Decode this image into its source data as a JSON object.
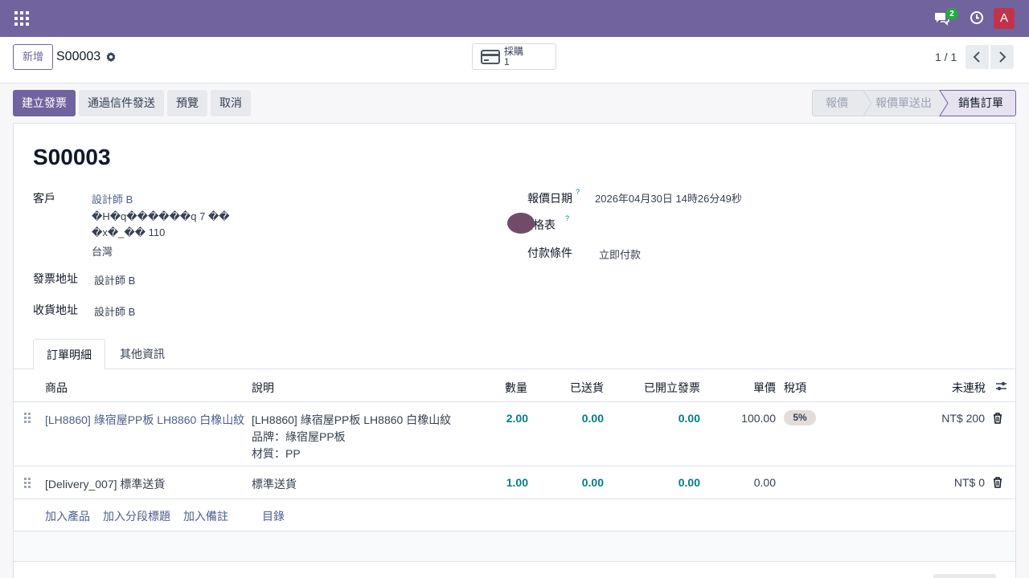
{
  "navbar": {
    "message_count": "2",
    "avatar_initial": "A",
    "accent_color": "#71639e"
  },
  "control": {
    "new_label": "新增",
    "record_name": "S00003",
    "smart_button": {
      "label": "採購",
      "count": "1"
    },
    "pager": "1 / 1"
  },
  "actions": {
    "create_invoice": "建立發票",
    "send_email": "通過信件發送",
    "preview": "預覽",
    "cancel": "取消"
  },
  "statusbar": {
    "stages": [
      "報價",
      "報價單送出",
      "銷售訂單"
    ],
    "active": "銷售訂單"
  },
  "form": {
    "title": "S00003",
    "customer_label": "客戶",
    "customer_name": "設計師 B",
    "customer_address_1": "�H�q������q 7 ��",
    "customer_address_2": "�x�_�� 110",
    "customer_country": "台灣",
    "invoice_address_label": "發票地址",
    "invoice_address": "設計師 B",
    "delivery_address_label": "收貨地址",
    "delivery_address": "設計師 B",
    "quote_date_label": "報價日期",
    "quote_date": "2026年04月30日 14時26分49秒",
    "pricelist_label": "價格表",
    "payment_terms_label": "付款條件",
    "payment_terms": "立即付款",
    "help_mark": "?"
  },
  "tabs": {
    "order_lines": "訂單明細",
    "other_info": "其他資訊"
  },
  "table": {
    "headers": {
      "product": "商品",
      "description": "說明",
      "quantity": "數量",
      "delivered": "已送貨",
      "invoiced": "已開立發票",
      "unit_price": "單價",
      "taxes": "稅項",
      "subtotal": "未連稅"
    },
    "rows": [
      {
        "product": "[LH8860] 綠宿屋PP板 LH8860 白橡山紋",
        "description_1": "[LH8860] 綠宿屋PP板 LH8860 白橡山紋",
        "description_2": "品牌：綠宿屋PP板",
        "description_3": "材質：PP",
        "quantity": "2.00",
        "delivered": "0.00",
        "invoiced": "0.00",
        "unit_price": "100.00",
        "tax": "5%",
        "subtotal": "NT$ 200"
      },
      {
        "product": "[Delivery_007] 標準送貨",
        "description_1": "標準送貨",
        "quantity": "1.00",
        "delivered": "0.00",
        "invoiced": "0.00",
        "unit_price": "0.00",
        "tax": "",
        "subtotal": "NT$ 0"
      }
    ],
    "add_product": "加入產品",
    "add_section": "加入分段標題",
    "add_note": "加入備註",
    "catalog": "目錄"
  }
}
